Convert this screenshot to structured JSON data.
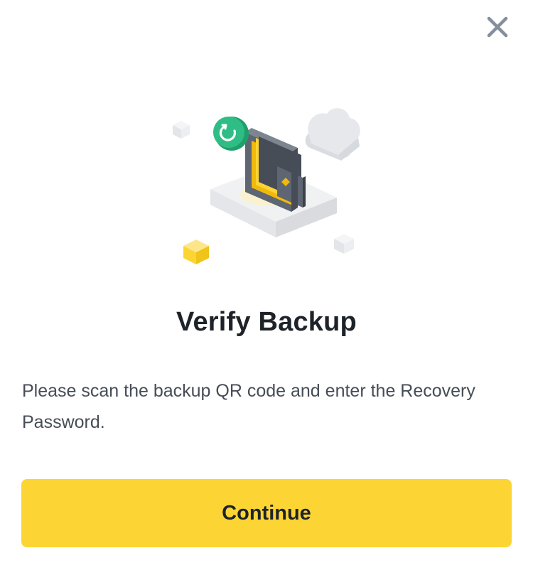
{
  "dialog": {
    "title": "Verify Backup",
    "description": "Please scan the backup QR code and enter the Recovery Password.",
    "continue_label": "Continue",
    "close_icon": "close-icon",
    "illustration": "wallet-backup-illustration"
  },
  "colors": {
    "accent": "#FCD535",
    "title_text": "#1E2329",
    "body_text": "#474D57",
    "close_icon": "#848E9C",
    "badge_green": "#2EBD85"
  }
}
